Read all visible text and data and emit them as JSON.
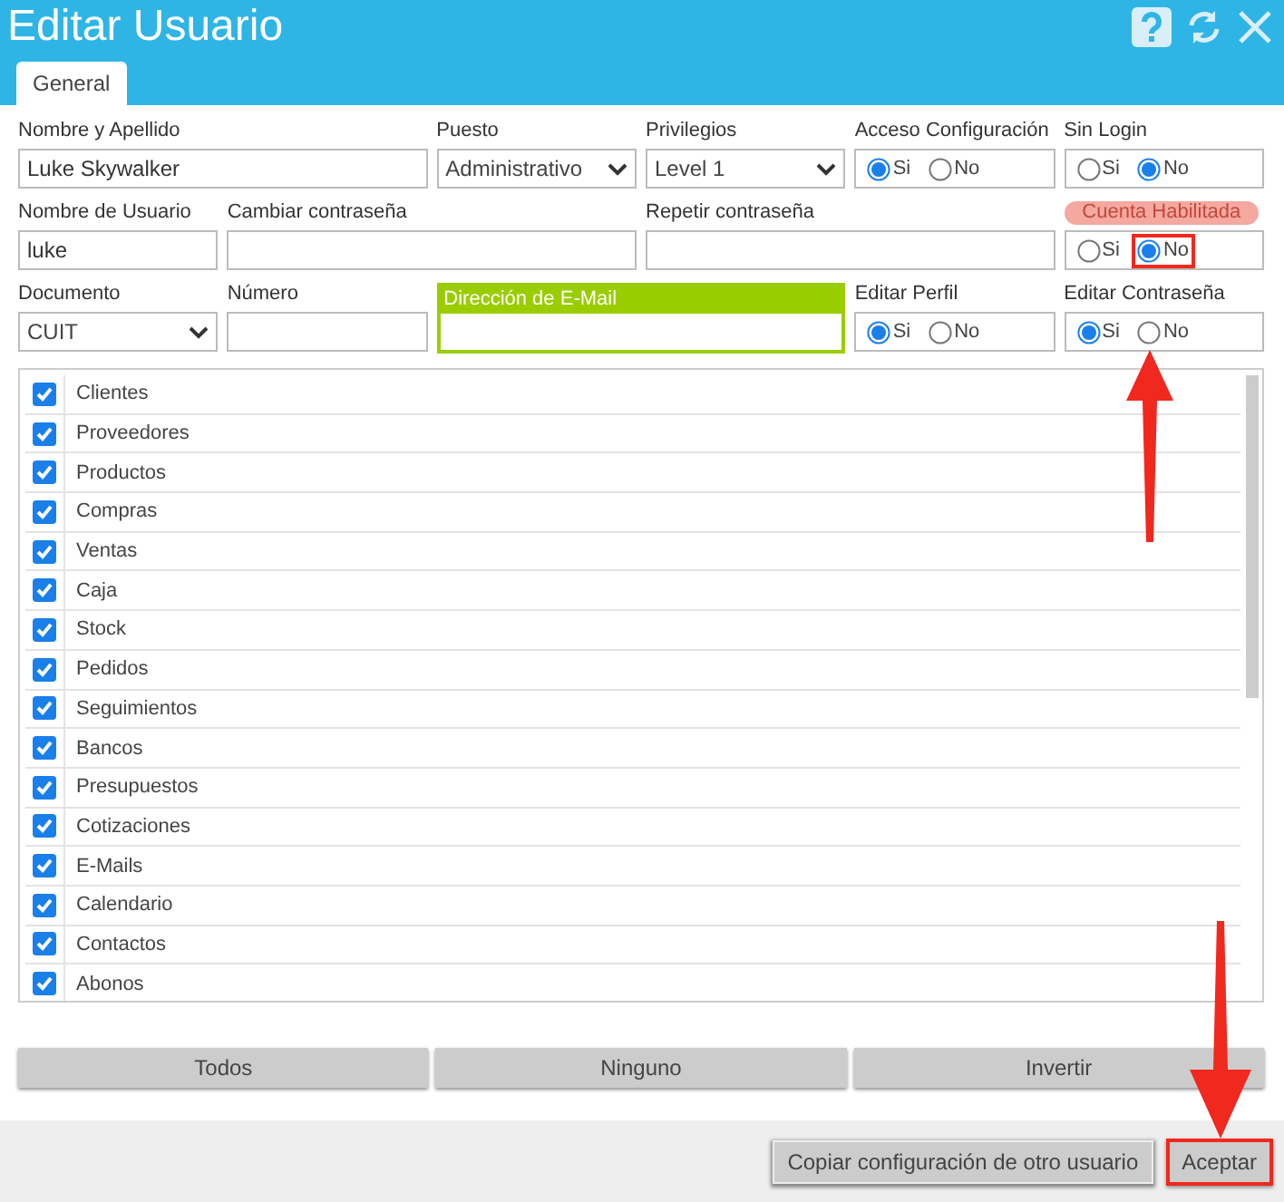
{
  "window": {
    "title": "Editar Usuario"
  },
  "tabs": [
    {
      "label": "General",
      "selected": true
    }
  ],
  "form": [
    {
      "kind": "text",
      "label": "Nombre y Apellido",
      "value": "Luke Skywalker"
    },
    {
      "kind": "select",
      "label": "Puesto",
      "value": "Administrativo"
    },
    {
      "kind": "select",
      "label": "Privilegios",
      "value": "Level 1"
    },
    {
      "kind": "radio",
      "label": "Acceso Configuración",
      "options": [
        {
          "label": "Si",
          "selected": true
        },
        {
          "label": "No",
          "selected": false
        }
      ]
    },
    {
      "kind": "radio",
      "label": "Sin Login",
      "options": [
        {
          "label": "Si",
          "selected": false
        },
        {
          "label": "No",
          "selected": true
        }
      ]
    },
    {
      "kind": "text",
      "label": "Nombre de Usuario",
      "value": "luke"
    },
    {
      "kind": "text",
      "label": "Cambiar contraseña"
    },
    {
      "kind": "text",
      "label": "Repetir contraseña"
    },
    {
      "kind": "radio",
      "label": "Cuenta Habilitada",
      "highlighted": true,
      "options": [
        {
          "label": "Si",
          "selected": false
        },
        {
          "label": "No",
          "selected": true,
          "annotated": true
        }
      ]
    },
    {
      "kind": "select",
      "label": "Documento",
      "value": "CUIT"
    },
    {
      "kind": "text",
      "label": "Número"
    },
    {
      "kind": "email",
      "label": "Dirección de E-Mail"
    },
    {
      "kind": "radio",
      "label": "Editar Perfil",
      "options": [
        {
          "label": "Si",
          "selected": true
        },
        {
          "label": "No",
          "selected": false
        }
      ]
    },
    {
      "kind": "radio",
      "label": "Editar Contraseña",
      "options": [
        {
          "label": "Si",
          "selected": true
        },
        {
          "label": "No",
          "selected": false
        }
      ]
    }
  ],
  "permissions": [
    {
      "label": "Clientes",
      "checked": true
    },
    {
      "label": "Proveedores",
      "checked": true
    },
    {
      "label": "Productos",
      "checked": true
    },
    {
      "label": "Compras",
      "checked": true
    },
    {
      "label": "Ventas",
      "checked": true
    },
    {
      "label": "Caja",
      "checked": true
    },
    {
      "label": "Stock",
      "checked": true
    },
    {
      "label": "Pedidos",
      "checked": true
    },
    {
      "label": "Seguimientos",
      "checked": true
    },
    {
      "label": "Bancos",
      "checked": true
    },
    {
      "label": "Presupuestos",
      "checked": true
    },
    {
      "label": "Cotizaciones",
      "checked": true
    },
    {
      "label": "E-Mails",
      "checked": true
    },
    {
      "label": "Calendario",
      "checked": true
    },
    {
      "label": "Contactos",
      "checked": true
    },
    {
      "label": "Abonos",
      "checked": true
    }
  ],
  "selection_buttons": [
    "Todos",
    "Ninguno",
    "Invertir"
  ],
  "footer_buttons": [
    {
      "label": "Copiar configuración de otro usuario",
      "annotated": false
    },
    {
      "label": "Aceptar",
      "annotated": true
    }
  ]
}
